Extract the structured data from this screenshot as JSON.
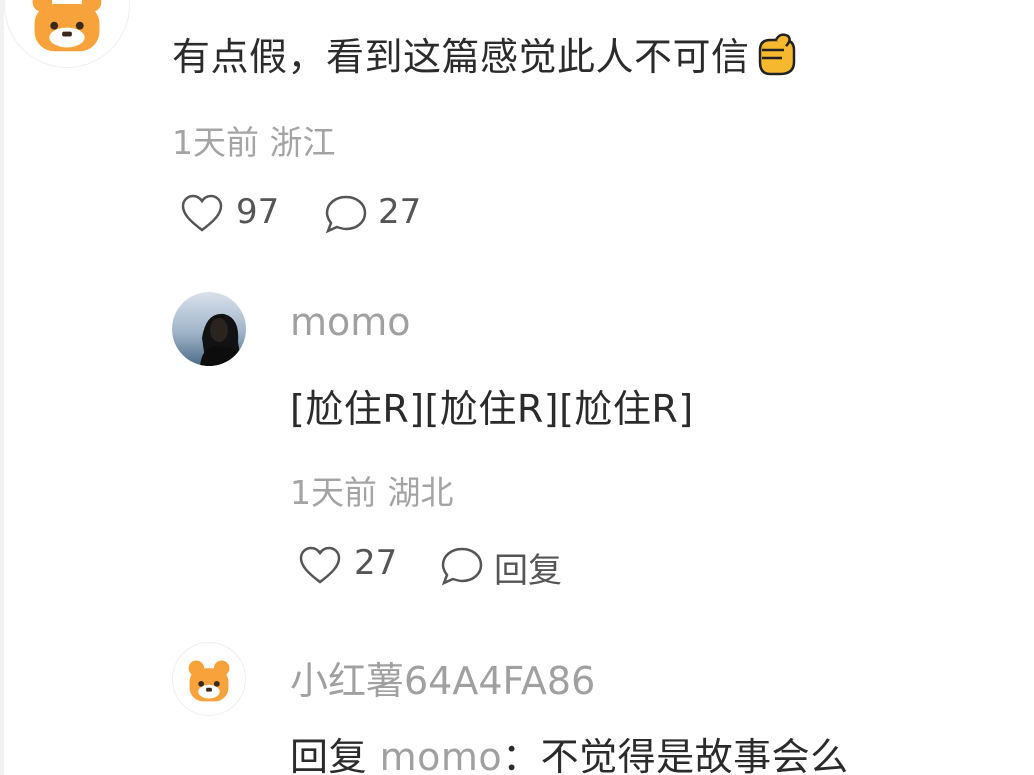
{
  "comments": [
    {
      "text": "有点假，看到这篇感觉此人不可信",
      "emoji_icon": "fist-emoji-icon",
      "time": "1天前",
      "location": "浙江",
      "likes": "97",
      "replies": "27"
    }
  ],
  "replies": [
    {
      "username": "momo",
      "text": "[尬住R][尬住R][尬住R]",
      "time": "1天前",
      "location": "湖北",
      "likes": "27",
      "reply_label": "回复"
    },
    {
      "username": "小红薯64A4FA86",
      "reply_prefix": "回复",
      "reply_target": "momo",
      "text": "：不觉得是故事会么"
    }
  ],
  "colors": {
    "avatar_orange": "#f7a23b",
    "text_main": "#2b2b2b",
    "text_meta": "#a4a4a4"
  }
}
